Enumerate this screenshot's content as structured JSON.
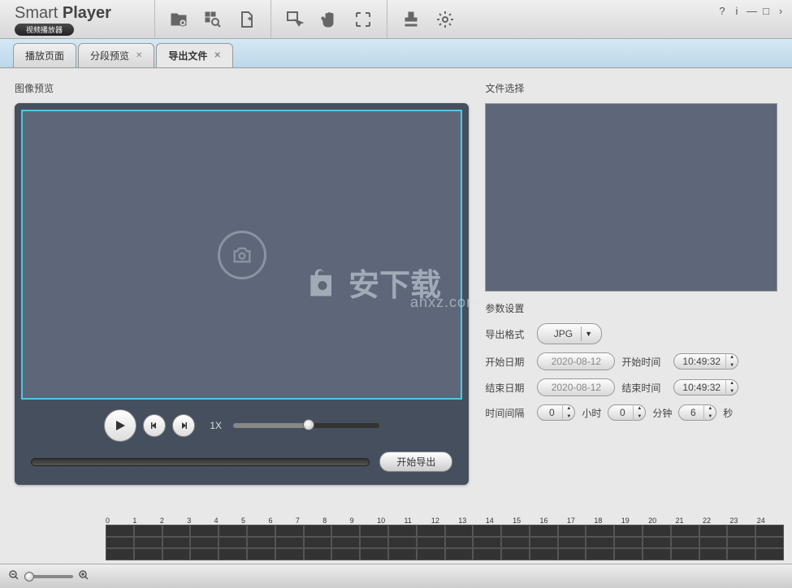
{
  "app": {
    "name_prefix": "Smart ",
    "name_bold": "Player",
    "badge": "视频播放器"
  },
  "tabs": [
    {
      "label": "播放页面",
      "closable": false
    },
    {
      "label": "分段预览",
      "closable": true
    },
    {
      "label": "导出文件",
      "closable": true,
      "active": true
    }
  ],
  "left": {
    "preview_label": "图像预览",
    "speed": "1X",
    "export_button": "开始导出"
  },
  "right": {
    "file_select_label": "文件选择",
    "params_label": "参数设置",
    "format_label": "导出格式",
    "format_value": "JPG",
    "start_date_label": "开始日期",
    "start_date": "2020-08-12",
    "start_time_label": "开始时间",
    "start_time": "10:49:32",
    "end_date_label": "结束日期",
    "end_date": "2020-08-12",
    "end_time_label": "结束时间",
    "end_time": "10:49:32",
    "interval_label": "时间间隔",
    "hours": "0",
    "hours_unit": "小时",
    "minutes": "0",
    "minutes_unit": "分钟",
    "seconds": "6",
    "seconds_unit": "秒"
  },
  "timeline": {
    "ticks": [
      "0",
      "1",
      "2",
      "3",
      "4",
      "5",
      "6",
      "7",
      "8",
      "9",
      "10",
      "11",
      "12",
      "13",
      "14",
      "15",
      "16",
      "17",
      "18",
      "19",
      "20",
      "21",
      "22",
      "23",
      "24"
    ]
  },
  "watermark": {
    "text": "安下载",
    "domain": "anxz.com"
  }
}
